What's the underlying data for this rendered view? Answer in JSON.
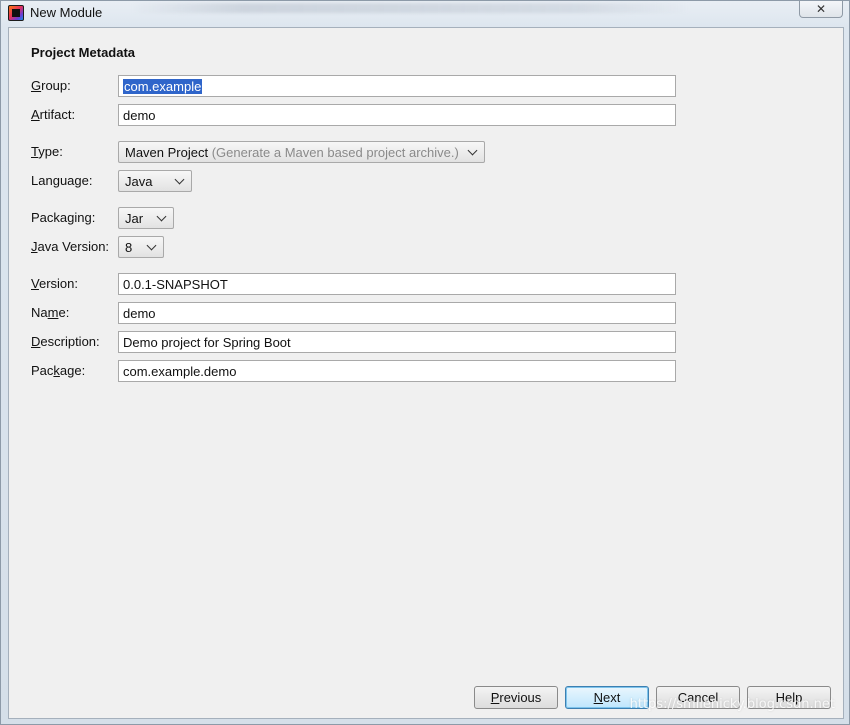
{
  "window": {
    "title": "New Module",
    "close_glyph": "✕"
  },
  "form": {
    "section_title": "Project Metadata",
    "group": {
      "label_mnemonic": "G",
      "label_rest": "roup:",
      "value": "com.example"
    },
    "artifact": {
      "label_mnemonic": "A",
      "label_rest": "rtifact:",
      "value": "demo"
    },
    "type": {
      "label_mnemonic": "T",
      "label_rest": "ype:",
      "value": "Maven Project",
      "hint": "(Generate a Maven based project archive.)"
    },
    "language": {
      "label_pre": "Lan",
      "label_mnemonic": "g",
      "label_rest": "uage:",
      "value": "Java"
    },
    "packaging": {
      "label_pre": "Packa",
      "label_mnemonic": "g",
      "label_rest": "ing:",
      "value": "Jar"
    },
    "java_version": {
      "label_mnemonic": "J",
      "label_rest": "ava Version:",
      "value": "8"
    },
    "version": {
      "label_mnemonic": "V",
      "label_rest": "ersion:",
      "value": "0.0.1-SNAPSHOT"
    },
    "name": {
      "label_pre": "Na",
      "label_mnemonic": "m",
      "label_rest": "e:",
      "value": "demo"
    },
    "description": {
      "label_mnemonic": "D",
      "label_rest": "escription:",
      "value": "Demo project for Spring Boot"
    },
    "package": {
      "label_pre": "Pac",
      "label_mnemonic": "k",
      "label_rest": "age:",
      "value": "com.example.demo"
    }
  },
  "buttons": {
    "previous": {
      "mnemonic": "P",
      "rest": "revious"
    },
    "next": {
      "mnemonic": "N",
      "rest": "ext"
    },
    "cancel": "Cancel",
    "help": "Help"
  },
  "watermark": "https://smilenicky.blog.csdn.net",
  "colors": {
    "selection": "#2f65ca",
    "default_button_border": "#3c7fb1"
  }
}
